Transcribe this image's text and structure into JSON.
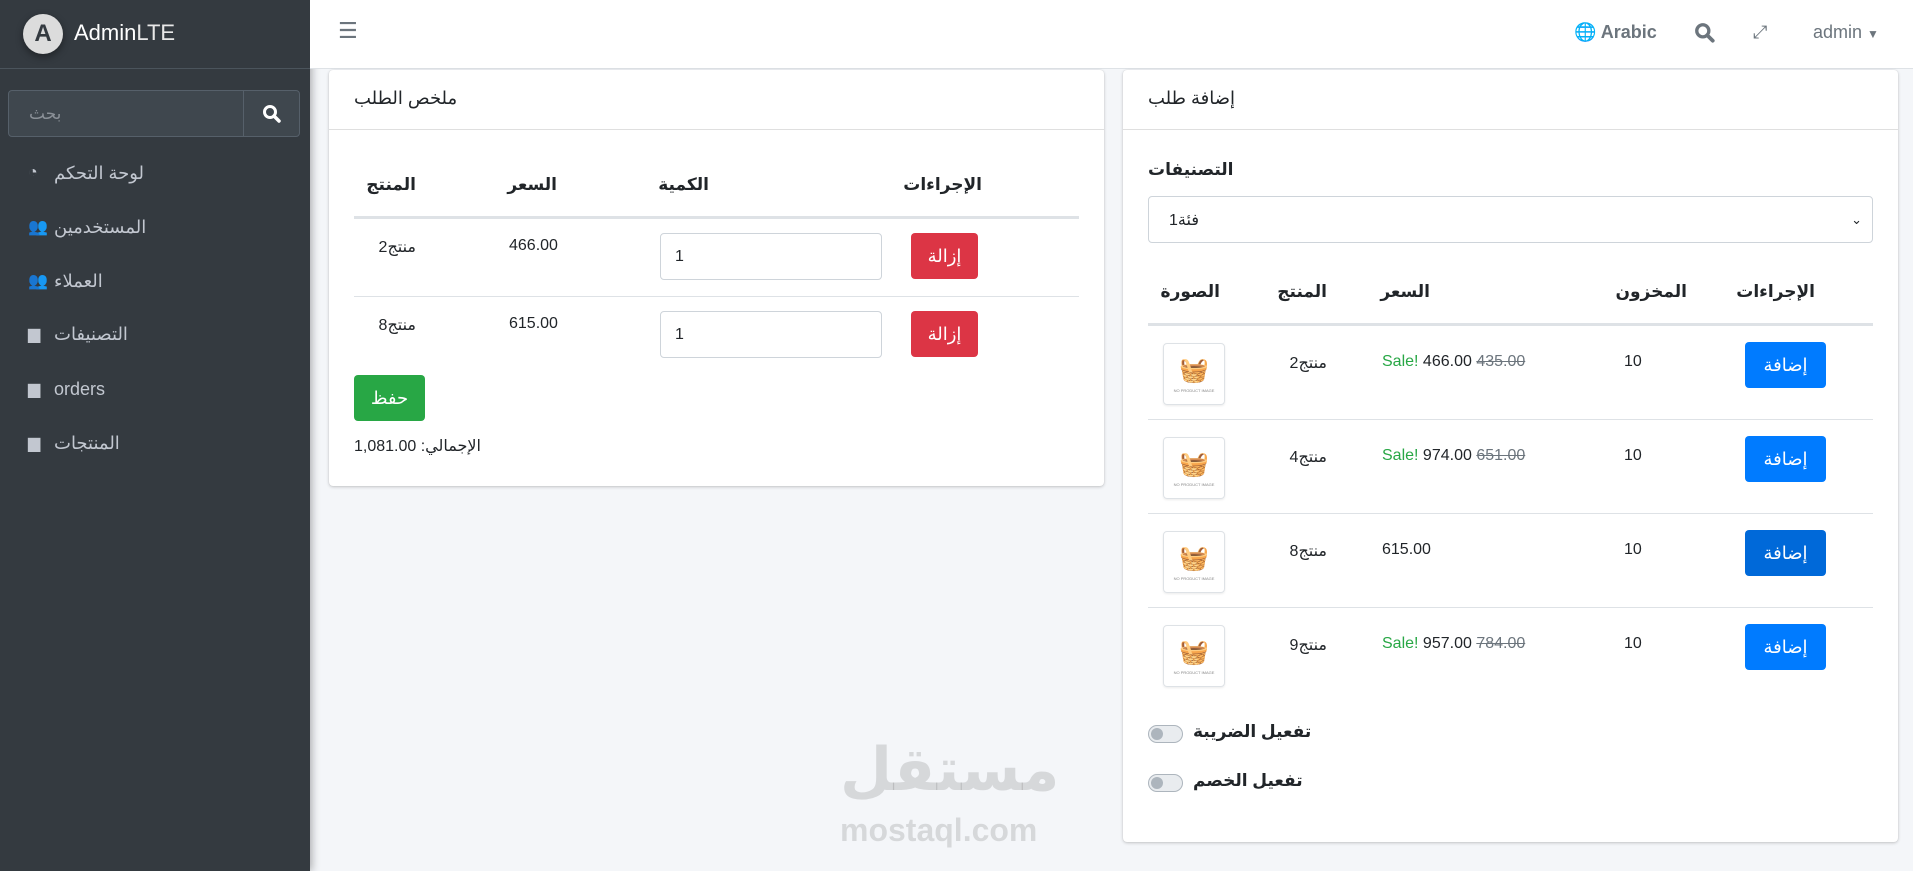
{
  "brand": {
    "name_bold": "Admin",
    "name_light": "LTE",
    "logo_letter": "A"
  },
  "sidebar": {
    "search_placeholder": "بحث",
    "items": [
      {
        "label": "لوحة التحكم",
        "icon": "tachometer-icon"
      },
      {
        "label": "المستخدمين",
        "icon": "users-icon"
      },
      {
        "label": "العملاء",
        "icon": "users-icon"
      },
      {
        "label": "التصنيفات",
        "icon": "box-icon"
      },
      {
        "label": "orders",
        "icon": "box-icon"
      },
      {
        "label": "المنتجات",
        "icon": "box-icon"
      }
    ]
  },
  "topbar": {
    "language": "Arabic",
    "user": "admin"
  },
  "summary": {
    "title": "ملخص الطلب",
    "headers": {
      "product": "المنتج",
      "price": "السعر",
      "qty": "الكمية",
      "actions": "الإجراءات"
    },
    "rows": [
      {
        "product": "منتج2",
        "price": "466.00",
        "qty": "1",
        "remove": "إزالة"
      },
      {
        "product": "منتج8",
        "price": "615.00",
        "qty": "1",
        "remove": "إزالة"
      }
    ],
    "save": "حفظ",
    "total_label": "الإجمالي:",
    "total": "1,081.00"
  },
  "add_order": {
    "title": "إضافة طلب",
    "categories_label": "التصنيفات",
    "category_selected": "فئة1",
    "headers": {
      "image": "الصورة",
      "product": "المنتج",
      "price": "السعر",
      "stock": "المخزون",
      "actions": "الإجراءات"
    },
    "no_image": "NO PRODUCT IMAGE",
    "rows": [
      {
        "product": "منتج2",
        "sale": "Sale!",
        "price": "466.00",
        "old_price": "435.00",
        "stock": "10",
        "add": "إضافة"
      },
      {
        "product": "منتج4",
        "sale": "Sale!",
        "price": "974.00",
        "old_price": "651.00",
        "stock": "10",
        "add": "إضافة"
      },
      {
        "product": "منتج8",
        "sale": "",
        "price": "615.00",
        "old_price": "",
        "stock": "10",
        "add": "إضافة"
      },
      {
        "product": "منتج9",
        "sale": "Sale!",
        "price": "957.00",
        "old_price": "784.00",
        "stock": "10",
        "add": "إضافة"
      }
    ],
    "tax_toggle": "تفعيل الضريبة",
    "discount_toggle": "تفعيل الخصم",
    "tax_on": false,
    "discount_on": false
  },
  "watermark": {
    "arabic": "مستقل",
    "latin": "mostaql.com"
  },
  "colors": {
    "primary": "#007bff",
    "danger": "#dc3545",
    "success": "#28a745",
    "sidebar": "#343a40"
  }
}
